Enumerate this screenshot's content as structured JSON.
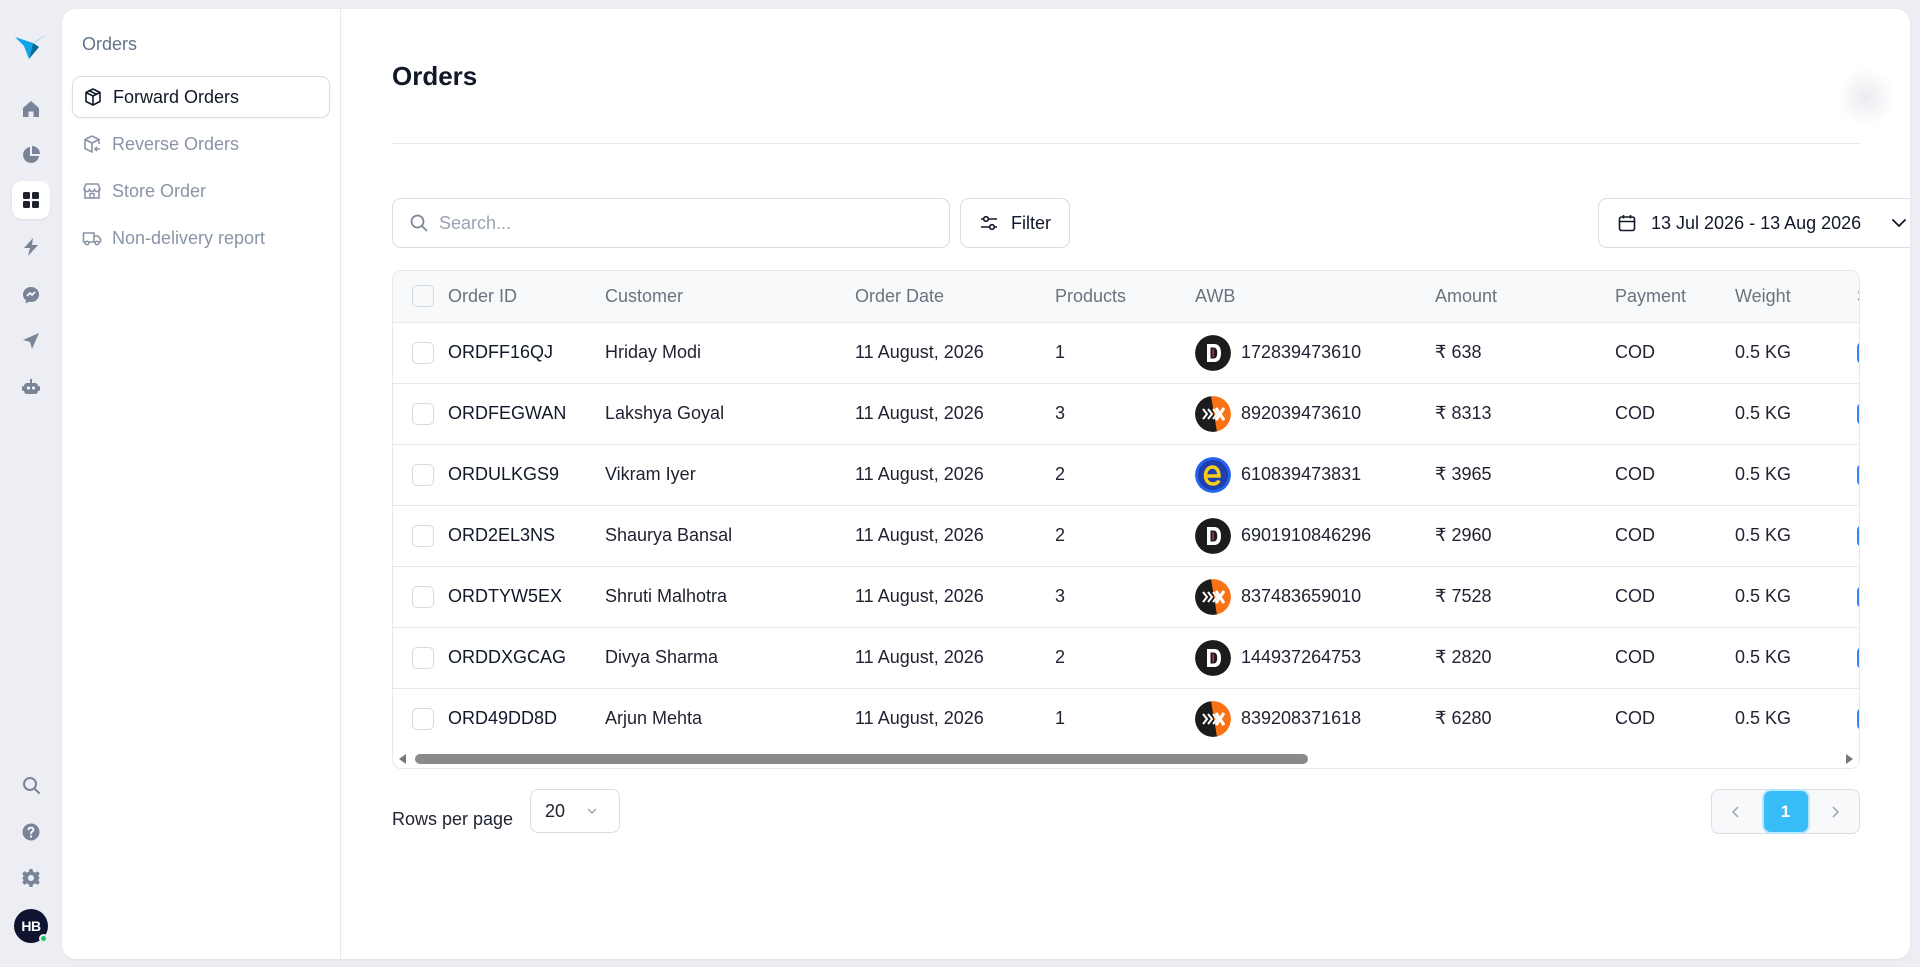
{
  "rail": {
    "items": [
      {
        "icon": "home-icon"
      },
      {
        "icon": "pie-chart-icon"
      },
      {
        "icon": "grid-icon",
        "active": true
      },
      {
        "icon": "lightning-icon"
      },
      {
        "icon": "chat-icon"
      },
      {
        "icon": "send-icon"
      },
      {
        "icon": "bot-icon"
      }
    ],
    "bottom": [
      {
        "icon": "search-icon"
      },
      {
        "icon": "help-icon"
      },
      {
        "icon": "gear-icon"
      }
    ],
    "avatar": "HB"
  },
  "subnav": {
    "title": "Orders",
    "items": [
      {
        "label": "Forward Orders",
        "icon": "package-icon",
        "active": true
      },
      {
        "label": "Reverse Orders",
        "icon": "return-package-icon"
      },
      {
        "label": "Store Order",
        "icon": "store-icon"
      },
      {
        "label": "Non-delivery report",
        "icon": "truck-icon"
      }
    ]
  },
  "page": {
    "title": "Orders",
    "search_placeholder": "Search...",
    "filter_label": "Filter",
    "date_range": "13 Jul 2026 - 13 Aug 2026"
  },
  "table": {
    "columns": [
      "Order ID",
      "Customer",
      "Order Date",
      "Products",
      "AWB",
      "Amount",
      "Payment",
      "Weight",
      "S"
    ],
    "rows": [
      {
        "order_id": "ORDFF16QJ",
        "customer": "Hriday Modi",
        "date": "11 August, 2026",
        "products": "1",
        "carrier": "delhivery",
        "awb": "172839473610",
        "amount": "₹ 638",
        "payment": "COD",
        "weight": "0.5 KG"
      },
      {
        "order_id": "ORDFEGWAN",
        "customer": "Lakshya Goyal",
        "date": "11 August, 2026",
        "products": "3",
        "carrier": "xpressbees",
        "awb": "892039473610",
        "amount": "₹ 8313",
        "payment": "COD",
        "weight": "0.5 KG"
      },
      {
        "order_id": "ORDULKGS9",
        "customer": "Vikram Iyer",
        "date": "11 August, 2026",
        "products": "2",
        "carrier": "ekart",
        "awb": "610839473831",
        "amount": "₹ 3965",
        "payment": "COD",
        "weight": "0.5 KG"
      },
      {
        "order_id": "ORD2EL3NS",
        "customer": "Shaurya Bansal",
        "date": "11 August, 2026",
        "products": "2",
        "carrier": "delhivery",
        "awb": "6901910846296",
        "amount": "₹ 2960",
        "payment": "COD",
        "weight": "0.5 KG"
      },
      {
        "order_id": "ORDTYW5EX",
        "customer": "Shruti Malhotra",
        "date": "11 August, 2026",
        "products": "3",
        "carrier": "xpressbees",
        "awb": "837483659010",
        "amount": "₹ 7528",
        "payment": "COD",
        "weight": "0.5 KG"
      },
      {
        "order_id": "ORDDXGCAG",
        "customer": "Divya Sharma",
        "date": "11 August, 2026",
        "products": "2",
        "carrier": "delhivery",
        "awb": "144937264753",
        "amount": "₹ 2820",
        "payment": "COD",
        "weight": "0.5 KG"
      },
      {
        "order_id": "ORD49DD8D",
        "customer": "Arjun Mehta",
        "date": "11 August, 2026",
        "products": "1",
        "carrier": "xpressbees",
        "awb": "839208371618",
        "amount": "₹ 6280",
        "payment": "COD",
        "weight": "0.5 KG"
      }
    ]
  },
  "footer": {
    "rows_per_page_label": "Rows per page",
    "rows_per_page_value": "20",
    "current_page": "1"
  },
  "colors": {
    "accent": "#38bdf8",
    "logo": "#1d9bf0",
    "rail_icon": "#7a8499",
    "status_ring": "#3b82f6"
  }
}
